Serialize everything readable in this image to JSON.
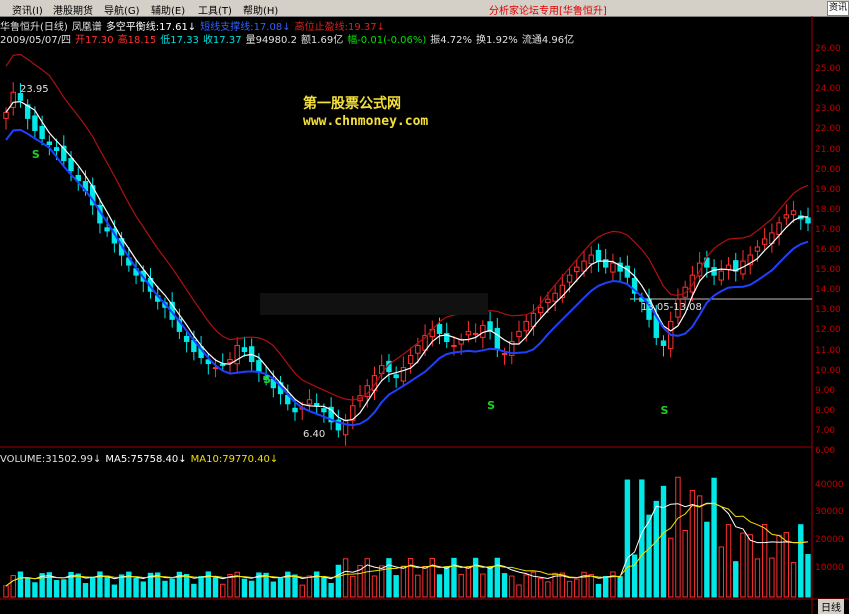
{
  "menu": {
    "items": [
      "资讯(I)",
      "港股期货",
      "导航(G)",
      "辅助(E)",
      "工具(T)",
      "帮助(H)"
    ],
    "title": "分析家论坛专用[华鲁恒升]",
    "search_btn": "资讯"
  },
  "header": {
    "line1": [
      {
        "text": "华鲁恒升(日线)",
        "color": "#e0e0e0"
      },
      {
        "text": "凤凰谱",
        "color": "#e0e0e0"
      },
      {
        "text": "多空平衡线:17.61↓",
        "color": "#ffffff"
      },
      {
        "text": "短线支撑线:17.08↓",
        "color": "#3060ff"
      },
      {
        "text": "高位止盈线:19.37↓",
        "color": "#e02020"
      }
    ],
    "line2": [
      {
        "text": "2009/05/07/四",
        "color": "#e0e0e0"
      },
      {
        "text": "开17.30",
        "color": "#ff3030"
      },
      {
        "text": "高18.15",
        "color": "#ff3030"
      },
      {
        "text": "低17.33",
        "color": "#00e0e0"
      },
      {
        "text": "收17.37",
        "color": "#00e0e0"
      },
      {
        "text": "量94980.2",
        "color": "#e0e0e0"
      },
      {
        "text": "额1.69亿",
        "color": "#e0e0e0"
      },
      {
        "text": "幅-0.01(-0.06%)",
        "color": "#00e000"
      },
      {
        "text": "振4.72%",
        "color": "#e0e0e0"
      },
      {
        "text": "换1.92%",
        "color": "#e0e0e0"
      },
      {
        "text": "流通4.96亿",
        "color": "#e0e0e0"
      }
    ]
  },
  "watermark": {
    "cn": "第一股票公式网",
    "url": "www.chnmoney.com"
  },
  "annotations": {
    "high": "23.95",
    "low": "6.40",
    "range": "13.05-13.08"
  },
  "volume": {
    "info": [
      {
        "text": "VOLUME:31502.99↓",
        "color": "#e0e0e0"
      },
      {
        "text": "MA5:75758.40↓",
        "color": "#ffffff"
      },
      {
        "text": "MA10:79770.40↓",
        "color": "#f0e000"
      }
    ]
  },
  "price_axis": [
    "26.00",
    "25.00",
    "24.00",
    "23.00",
    "22.00",
    "21.00",
    "20.00",
    "19.00",
    "18.00",
    "17.00",
    "16.00",
    "15.00",
    "14.00",
    "13.00",
    "12.00",
    "11.00",
    "10.00",
    "9.00",
    "8.00",
    "7.00",
    "6.00"
  ],
  "vol_axis": [
    "40000",
    "30000",
    "20000",
    "10000"
  ],
  "bottom_label": "日线",
  "colors": {
    "up": "#ff3030",
    "down": "#00e8e8",
    "ma_white": "#ffffff",
    "support_blue": "#2040ff",
    "resist_red": "#b01010"
  },
  "chart_data": {
    "type": "candlestick",
    "price_range": [
      6.0,
      26.6
    ],
    "closes": [
      22.9,
      23.9,
      23.5,
      22.6,
      22.0,
      21.6,
      21.3,
      21.0,
      20.5,
      20.0,
      19.5,
      19.0,
      18.3,
      17.4,
      17.0,
      16.4,
      15.8,
      15.3,
      14.8,
      14.5,
      14.0,
      13.5,
      13.2,
      12.6,
      12.0,
      11.5,
      11.0,
      10.7,
      10.4,
      10.2,
      10.3,
      10.6,
      11.3,
      11.0,
      10.5,
      10.0,
      9.6,
      9.2,
      8.9,
      8.4,
      8.0,
      8.2,
      8.6,
      8.3,
      8.0,
      7.5,
      7.1,
      7.6,
      8.3,
      8.8,
      9.3,
      9.8,
      10.3,
      10.0,
      9.7,
      10.2,
      10.8,
      11.3,
      11.8,
      12.1,
      11.9,
      11.5,
      11.3,
      11.6,
      12.0,
      11.9,
      12.3,
      12.0,
      11.1,
      10.9,
      11.5,
      12.0,
      12.5,
      12.9,
      13.2,
      13.6,
      13.9,
      14.3,
      14.8,
      15.2,
      15.5,
      15.8,
      15.5,
      15.2,
      15.4,
      15.0,
      14.7,
      13.9,
      13.5,
      12.6,
      11.7,
      11.3,
      12.5,
      13.6,
      14.2,
      14.8,
      15.4,
      15.2,
      14.8,
      15.0,
      15.3,
      15.0,
      15.5,
      15.8,
      16.2,
      16.6,
      16.9,
      17.4,
      17.8,
      18.0,
      17.6,
      17.4
    ],
    "support_line": 13.08,
    "volume_range": [
      0,
      47000
    ]
  }
}
